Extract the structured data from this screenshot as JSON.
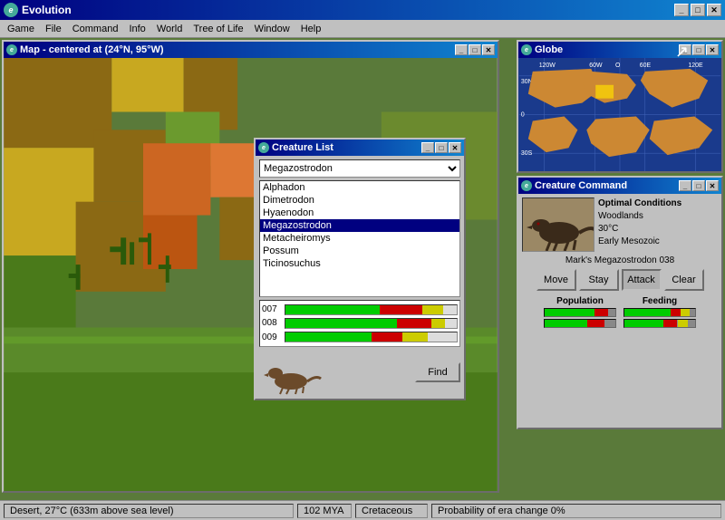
{
  "app": {
    "title": "Evolution",
    "icon": "e"
  },
  "menu": {
    "items": [
      "Game",
      "File",
      "Command",
      "Info",
      "World",
      "Tree of Life",
      "Window",
      "Help"
    ]
  },
  "map_window": {
    "title": "Map - centered at (24°N, 95°W)",
    "controls": [
      "_",
      "□",
      "✕"
    ]
  },
  "globe_window": {
    "title": "Globe",
    "controls": [
      "_",
      "□",
      "✕"
    ]
  },
  "creature_cmd_window": {
    "title": "Creature Command",
    "controls": [
      "_",
      "□",
      "✕"
    ],
    "creature_name": "Mark's Megazostrodon 038",
    "optimal": {
      "title": "Optimal Conditions",
      "habitat": "Woodlands",
      "temp": "30°C",
      "era": "Early Mesozoic"
    },
    "buttons": [
      "Move",
      "Stay",
      "Attack",
      "Clear"
    ],
    "stats": {
      "population_label": "Population",
      "feeding_label": "Feeding"
    }
  },
  "creature_list_window": {
    "title": "Creature List",
    "controls": [
      "_",
      "□",
      "✕"
    ],
    "selected_creature": "Megazostrodon",
    "creatures": [
      "Alphadon",
      "Dimetrodon",
      "Hyaenodon",
      "Megazostrodon",
      "Metacheiromys",
      "Possum",
      "Ticinosuchus"
    ],
    "rows": [
      "007",
      "008",
      "009"
    ],
    "find_label": "Find"
  },
  "status_bar": {
    "terrain": "Desert, 27°C (633m above sea level)",
    "mya": "102 MYA",
    "era": "Cretaceous",
    "probability": "Probability of era change 0%"
  },
  "colors": {
    "dark_blue": "#000080",
    "light_blue": "#1084d0",
    "green_bar": "#00cc00",
    "red_bar": "#cc0000",
    "yellow_bar": "#cccc00",
    "selected_bg": "#000080"
  }
}
